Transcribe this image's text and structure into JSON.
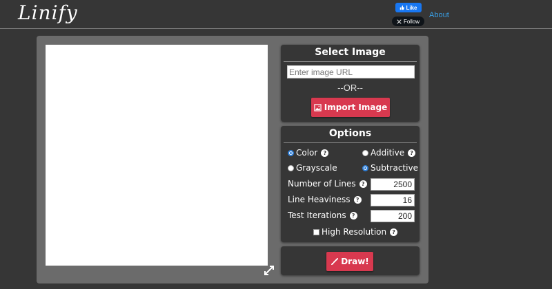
{
  "header": {
    "logo": "Linify",
    "fb_like": "Like",
    "x_follow": "Follow",
    "about": "About"
  },
  "select_image": {
    "title": "Select Image",
    "url_placeholder": "Enter image URL",
    "or_text": "--OR--",
    "import_button": "Import Image"
  },
  "options": {
    "title": "Options",
    "color_label": "Color",
    "additive_label": "Additive",
    "grayscale_label": "Grayscale",
    "subtractive_label": "Subtractive",
    "lines_label": "Number of Lines",
    "lines_value": "2500",
    "heaviness_label": "Line Heaviness",
    "heaviness_value": "16",
    "iterations_label": "Test Iterations",
    "iterations_value": "200",
    "high_res_label": "High Resolution",
    "help_glyph": "?"
  },
  "draw": {
    "button": "Draw!"
  },
  "colors": {
    "background": "#363636",
    "panel": "#6b6b6b",
    "accent_red": "#d8394f",
    "link_blue": "#3aa0e6",
    "radio_blue": "#2f7fd8"
  },
  "icons": {
    "expand": "expand-icon",
    "image": "image-icon",
    "brush": "brush-icon",
    "help": "help-icon"
  }
}
